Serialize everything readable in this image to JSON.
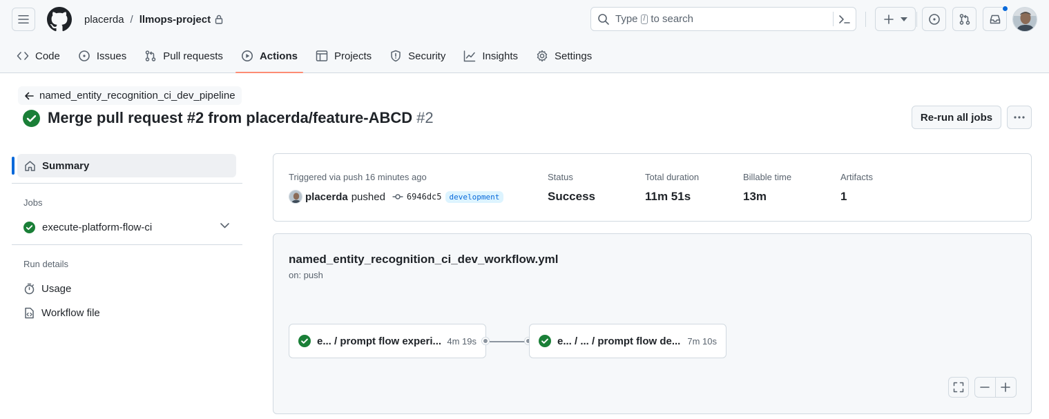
{
  "header": {
    "owner": "placerda",
    "separator": "/",
    "repo": "llmops-project",
    "search_prefix": "Type",
    "search_key": "/",
    "search_suffix": "to search",
    "icons": [
      "hamburger-icon",
      "github-logo",
      "lock-icon",
      "search-icon",
      "command-palette-icon",
      "plus-icon",
      "triangle-down-icon",
      "issue-opened-icon",
      "git-pull-request-icon",
      "inbox-icon"
    ],
    "accent": "#0969da"
  },
  "tabs": [
    {
      "label": "Code",
      "icon": "code-icon"
    },
    {
      "label": "Issues",
      "icon": "issue-opened-icon"
    },
    {
      "label": "Pull requests",
      "icon": "git-pull-request-icon"
    },
    {
      "label": "Actions",
      "icon": "play-icon",
      "active": true
    },
    {
      "label": "Projects",
      "icon": "table-icon"
    },
    {
      "label": "Security",
      "icon": "shield-icon"
    },
    {
      "label": "Insights",
      "icon": "graph-icon"
    },
    {
      "label": "Settings",
      "icon": "gear-icon"
    }
  ],
  "run": {
    "back_label": "named_entity_recognition_ci_dev_pipeline",
    "title": "Merge pull request #2 from placerda/feature-ABCD",
    "number": "#2",
    "rerun_label": "Re-run all jobs",
    "status_color": "#1a7f37"
  },
  "sidebar": {
    "summary_label": "Summary",
    "jobs_heading": "Jobs",
    "job_label": "execute-platform-flow-ci",
    "run_details_heading": "Run details",
    "usage_label": "Usage",
    "workflow_file_label": "Workflow file"
  },
  "summary": {
    "triggered_label": "Triggered via push 16 minutes ago",
    "actor": "placerda",
    "action": "pushed",
    "sha": "6946dc5",
    "branch": "development",
    "status_label": "Status",
    "status_value": "Success",
    "duration_label": "Total duration",
    "duration_value": "11m 51s",
    "billable_label": "Billable time",
    "billable_value": "13m",
    "artifacts_label": "Artifacts",
    "artifacts_value": "1"
  },
  "workflow": {
    "file": "named_entity_recognition_ci_dev_workflow.yml",
    "trigger": "on: push",
    "jobs": [
      {
        "name": "e... / prompt flow experi...",
        "duration": "4m 19s"
      },
      {
        "name": "e... / ... / prompt flow de...",
        "duration": "7m 10s"
      }
    ]
  }
}
